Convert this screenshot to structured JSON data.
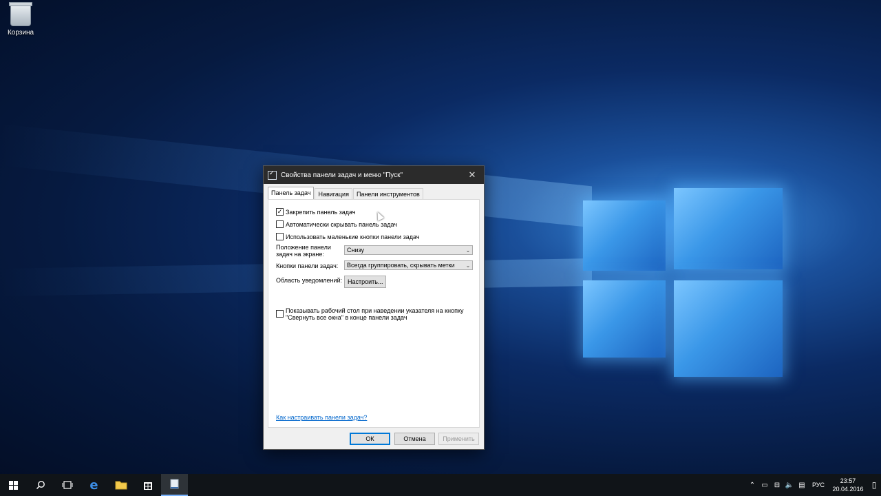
{
  "desktop": {
    "icons": [
      {
        "label": "Корзина"
      }
    ]
  },
  "dialog": {
    "title": "Свойства панели задач и меню \"Пуск\"",
    "tabs": [
      {
        "label": "Панель задач",
        "active": true
      },
      {
        "label": "Навигация",
        "active": false
      },
      {
        "label": "Панели инструментов",
        "active": false
      }
    ],
    "options": {
      "lock_taskbar": {
        "label": "Закрепить панель задач",
        "checked": true
      },
      "auto_hide": {
        "label": "Автоматически скрывать панель задач",
        "checked": false
      },
      "small_buttons": {
        "label": "Использовать маленькие кнопки панели задач",
        "checked": false
      },
      "peek": {
        "label_line1": "Показывать рабочий стол при наведении указателя на кнопку",
        "label_line2": "\"Свернуть все окна\" в конце панели задач",
        "checked": false
      }
    },
    "position_label_line1": "Положение панели",
    "position_label_line2": "задач на экране:",
    "position_value": "Снизу",
    "buttons_label": "Кнопки панели задач:",
    "buttons_value": "Всегда группировать, скрывать метки",
    "notif_label": "Область уведомлений:",
    "customize_label": "Настроить...",
    "help_link": "Как настраивать панели задач?",
    "ok_label": "ОК",
    "cancel_label": "Отмена",
    "apply_label": "Применить"
  },
  "taskbar": {
    "language": "РУС",
    "time": "23:57",
    "date": "20.04.2016"
  }
}
